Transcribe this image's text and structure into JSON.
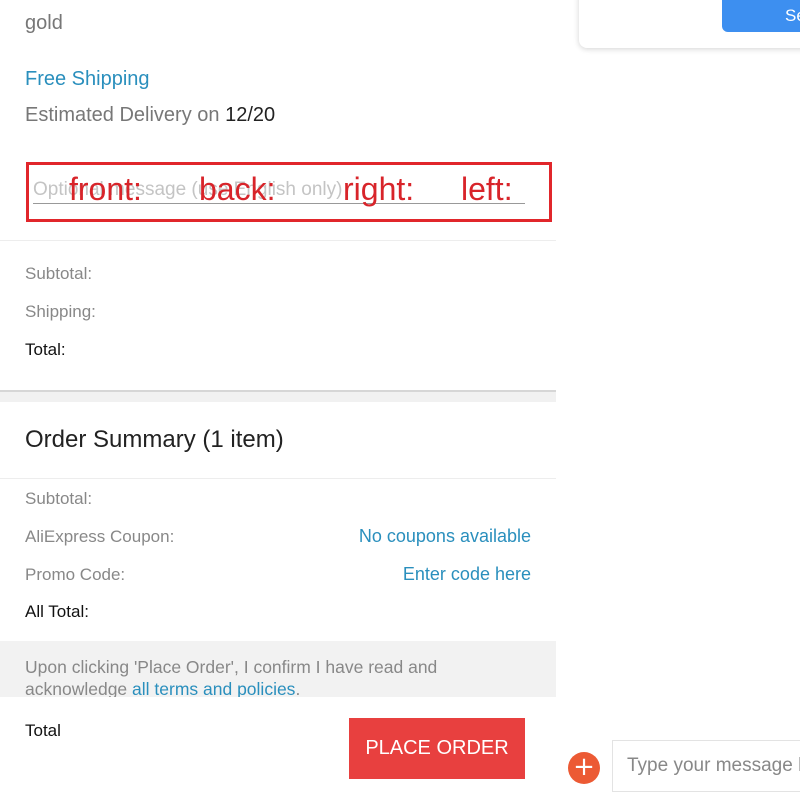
{
  "product": {
    "variant": "gold",
    "shipping": "Free Shipping",
    "delivery_prefix": "Estimated Delivery on ",
    "delivery_date": "12/20"
  },
  "message": {
    "placeholder": "Optional message (use English only)",
    "annotations": [
      "front:",
      "back:",
      "right:",
      "left:"
    ]
  },
  "store_totals": {
    "subtotal_label": "Subtotal:",
    "shipping_label": "Shipping:",
    "total_label": "Total:"
  },
  "order_summary": {
    "title": "Order Summary (1 item)",
    "subtotal_label": "Subtotal:",
    "coupon_label": "AliExpress Coupon:",
    "coupon_value": "No coupons available",
    "promo_label": "Promo Code:",
    "promo_value": "Enter code here",
    "all_total_label": "All Total:"
  },
  "notice": {
    "text": "Upon clicking 'Place Order', I confirm I have read and acknowledge ",
    "link": "all terms and policies",
    "suffix": "."
  },
  "footer": {
    "total_label": "Total",
    "place_order_label": "PLACE ORDER"
  },
  "popup": {
    "button_label": "Se"
  },
  "chat": {
    "placeholder": "Type your message here"
  },
  "colors": {
    "link": "#2a8fbd",
    "accent_red": "#e8403f",
    "annotation_red": "#e1262b",
    "blue_button": "#3d8ff0",
    "plus_orange": "#ec5a34"
  },
  "icons": {
    "plus": "plus-icon"
  }
}
